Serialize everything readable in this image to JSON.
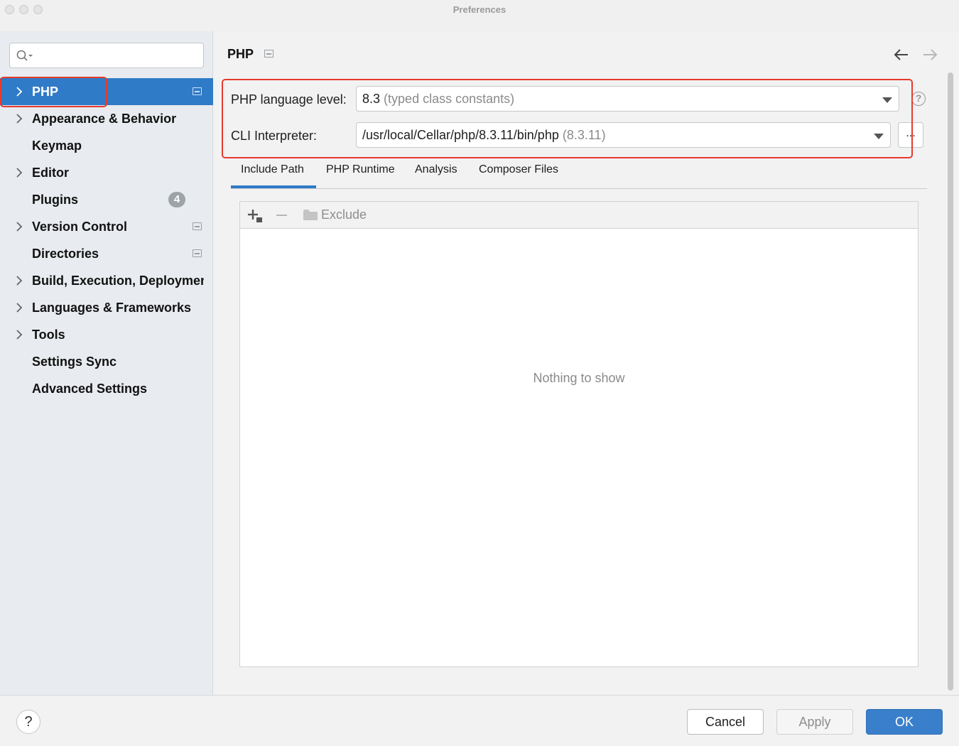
{
  "window": {
    "title": "Preferences"
  },
  "sidebar": {
    "search": {
      "placeholder": ""
    },
    "items": [
      {
        "label": "PHP",
        "expandable": true,
        "selected": true,
        "project_icon": true
      },
      {
        "label": "Appearance & Behavior",
        "expandable": true
      },
      {
        "label": "Keymap",
        "expandable": false
      },
      {
        "label": "Editor",
        "expandable": true
      },
      {
        "label": "Plugins",
        "expandable": false,
        "badge": "4"
      },
      {
        "label": "Version Control",
        "expandable": true,
        "project_icon": true
      },
      {
        "label": "Directories",
        "expandable": false,
        "project_icon": true
      },
      {
        "label": "Build, Execution, Deployment",
        "expandable": true
      },
      {
        "label": "Languages & Frameworks",
        "expandable": true
      },
      {
        "label": "Tools",
        "expandable": true
      },
      {
        "label": "Settings Sync",
        "expandable": false
      },
      {
        "label": "Advanced Settings",
        "expandable": false
      }
    ]
  },
  "main": {
    "title": "PHP",
    "language_level": {
      "label": "PHP language level:",
      "value": "8.3",
      "hint": "(typed class constants)"
    },
    "cli_interpreter": {
      "label": "CLI Interpreter:",
      "value": "/usr/local/Cellar/php/8.3.11/bin/php",
      "hint": "(8.3.11)",
      "browse_label": "..."
    },
    "help_glyph": "?",
    "tabs": [
      {
        "label": "Include Path",
        "active": true
      },
      {
        "label": "PHP Runtime"
      },
      {
        "label": "Analysis"
      },
      {
        "label": "Composer Files"
      }
    ],
    "toolbar": {
      "exclude_label": "Exclude"
    },
    "empty_text": "Nothing to show"
  },
  "footer": {
    "help_glyph": "?",
    "cancel_label": "Cancel",
    "apply_label": "Apply",
    "ok_label": "OK"
  },
  "colors": {
    "accent": "#2f7bc8",
    "highlight_box": "#e53a2e",
    "sidebar_bg": "#e8ebef"
  },
  "icons": {
    "back": "arrow-left-icon",
    "forward": "arrow-right-icon",
    "search": "search-icon",
    "add": "add-icon",
    "remove": "remove-icon",
    "folder": "folder-icon"
  }
}
